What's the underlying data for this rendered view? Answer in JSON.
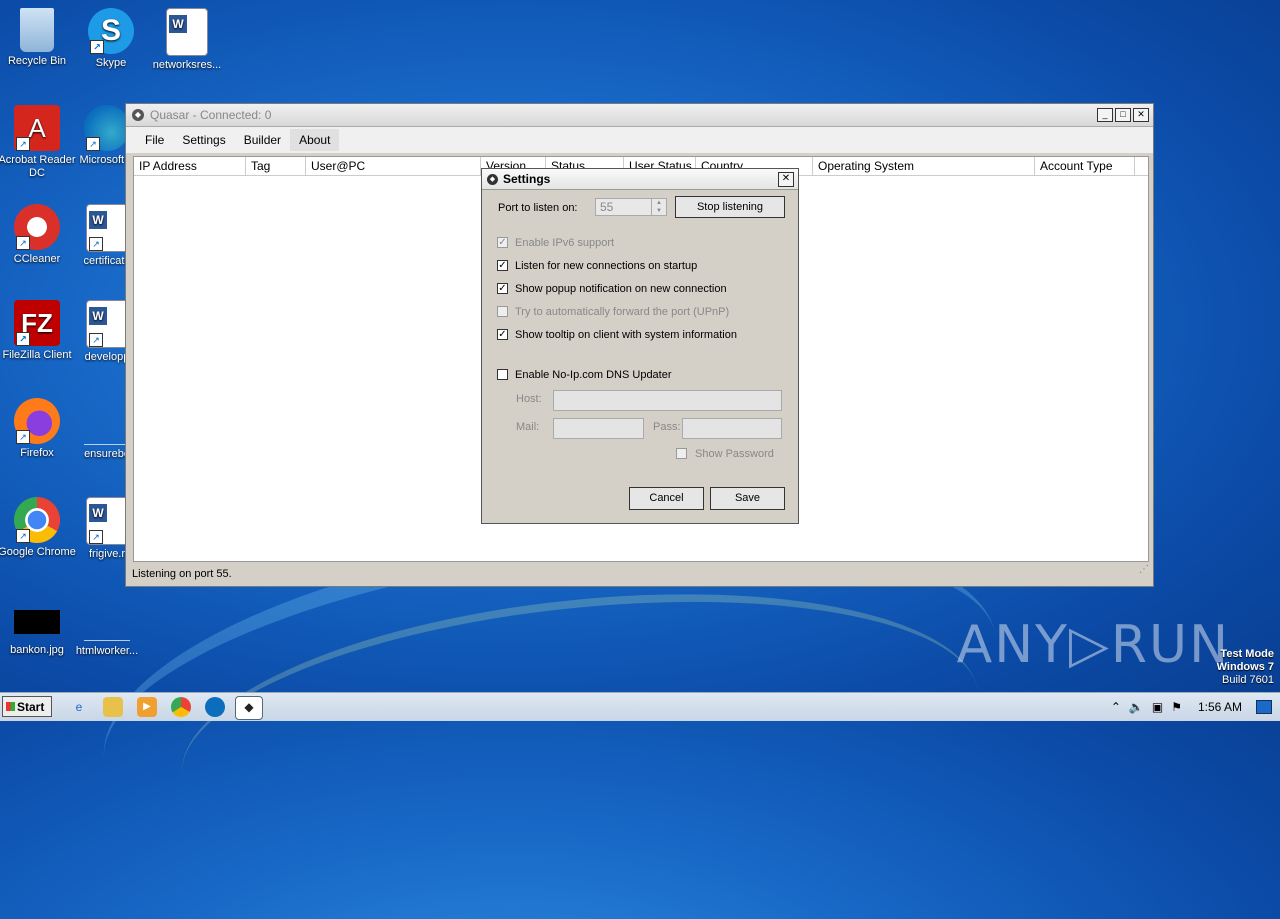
{
  "desktop": {
    "icons": [
      {
        "label": "Recycle Bin",
        "icon": "recycle-bin-icon"
      },
      {
        "label": "Skype",
        "icon": "skype-icon"
      },
      {
        "label": "networksres...",
        "icon": "word-doc-icon"
      },
      {
        "label": "Acrobat Reader DC",
        "icon": "acrobat-icon"
      },
      {
        "label": "Microsoft E",
        "icon": "edge-icon"
      },
      {
        "label": "CCleaner",
        "icon": "ccleaner-icon"
      },
      {
        "label": "certificate",
        "icon": "word-doc-icon"
      },
      {
        "label": "FileZilla Client",
        "icon": "filezilla-icon"
      },
      {
        "label": "developp",
        "icon": "word-doc-icon"
      },
      {
        "label": "Firefox",
        "icon": "firefox-icon"
      },
      {
        "label": "ensurebo",
        "icon": "blank-file-icon"
      },
      {
        "label": "Google Chrome",
        "icon": "chrome-icon"
      },
      {
        "label": "frigive.r",
        "icon": "word-doc-icon"
      },
      {
        "label": "bankon.jpg",
        "icon": "image-file-icon"
      },
      {
        "label": "htmlworker...",
        "icon": "blank-file-icon"
      }
    ]
  },
  "quasar": {
    "title": "Quasar - Connected: 0",
    "menu": [
      "File",
      "Settings",
      "Builder",
      "About"
    ],
    "columns": [
      "IP Address",
      "Tag",
      "User@PC",
      "Version",
      "Status",
      "User Status",
      "Country",
      "Operating System",
      "Account Type"
    ],
    "status": "Listening on port 55."
  },
  "settings": {
    "title": "Settings",
    "port_label": "Port to listen on:",
    "port_value": "55",
    "stop_button": "Stop listening",
    "options": [
      {
        "label": "Enable IPv6 support",
        "checked": true,
        "enabled": false
      },
      {
        "label": "Listen for new connections on startup",
        "checked": true,
        "enabled": true
      },
      {
        "label": "Show popup notification on new connection",
        "checked": true,
        "enabled": true
      },
      {
        "label": "Try to automatically forward the port (UPnP)",
        "checked": false,
        "enabled": false
      },
      {
        "label": "Show tooltip on client with system information",
        "checked": true,
        "enabled": true
      }
    ],
    "noip_label": "Enable No-Ip.com DNS Updater",
    "host_label": "Host:",
    "mail_label": "Mail:",
    "pass_label": "Pass:",
    "show_password": "Show Password",
    "cancel": "Cancel",
    "save": "Save"
  },
  "taskbar": {
    "start": "Start",
    "time": "1:56 AM"
  },
  "overlay": {
    "watermark": "ANY▷RUN",
    "mode": "Test Mode",
    "os": "Windows 7",
    "build": "Build 7601"
  }
}
